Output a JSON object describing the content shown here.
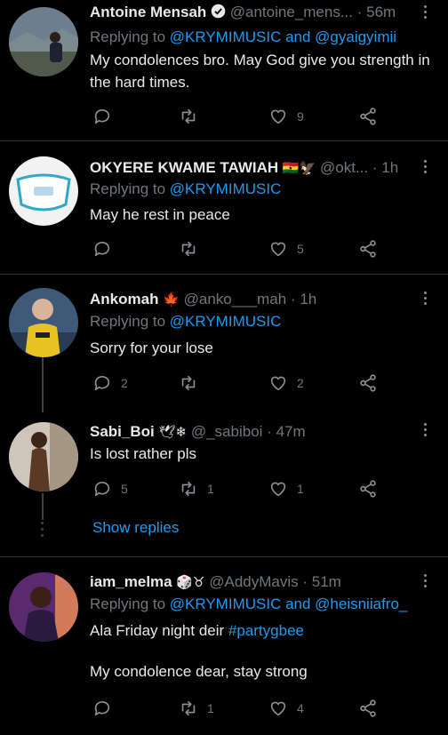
{
  "tweets": [
    {
      "name": "Antoine Mensah",
      "handle": "@antoine_mens...",
      "time": "56m",
      "replying_prefix": "Replying to ",
      "replying_mentions": "@KRYMIMUSIC and @gyaigyimii",
      "text": "My condolences bro. May God give you strength in the hard times.",
      "replies": "",
      "retweets": "",
      "likes": "9"
    },
    {
      "name": "OKYERE KWAME TAWIAH",
      "name_emoji": "🇬🇭🦅",
      "handle": "@okt...",
      "time": "1h",
      "replying_prefix": "Replying to ",
      "replying_mentions": "@KRYMIMUSIC",
      "text": "May he rest in peace",
      "replies": "",
      "retweets": "",
      "likes": "5"
    },
    {
      "name": "Ankomah",
      "name_emoji": "🍁",
      "handle": "@anko___mah",
      "time": "1h",
      "replying_prefix": "Replying to ",
      "replying_mentions": "@KRYMIMUSIC",
      "text": "Sorry for your lose",
      "replies": "2",
      "retweets": "",
      "likes": "2"
    },
    {
      "name": "Sabi_Boi",
      "name_emoji": "🕊❄",
      "handle": "@_sabiboi",
      "time": "47m",
      "text": "Is lost rather pls",
      "replies": "5",
      "retweets": "1",
      "likes": "1"
    },
    {
      "name": "iam_melma",
      "name_emoji": "🎲♉",
      "handle": "@AddyMavis",
      "time": "51m",
      "replying_prefix": "Replying to ",
      "replying_mentions": "@KRYMIMUSIC and @heisniiafro_",
      "text_line1": "Ala Friday night deir ",
      "hashtag": "#partygbee",
      "text_line2": "My condolence dear, stay strong",
      "replies": "",
      "retweets": "1",
      "likes": "4"
    }
  ],
  "show_replies": "Show replies",
  "colors": {
    "background": "#000000",
    "link": "#1d9bf0",
    "muted": "#71767b",
    "divider": "#2f3336"
  },
  "icons": [
    "reply-icon",
    "retweet-icon",
    "like-icon",
    "share-icon",
    "verified-badge-icon",
    "more-options-icon"
  ]
}
